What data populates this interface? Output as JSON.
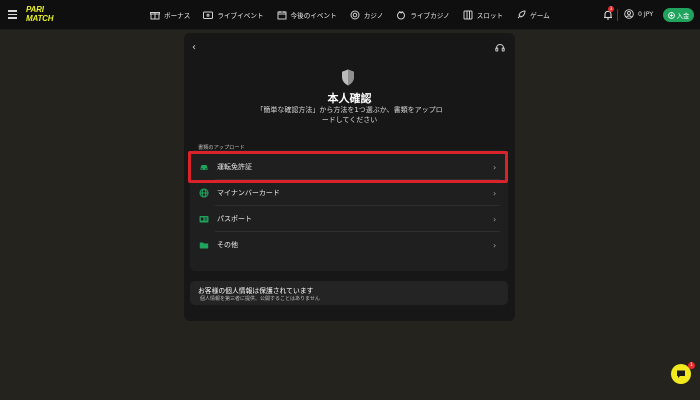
{
  "header": {
    "logo_line1": "PARI",
    "logo_line2": "MATCH",
    "nav": [
      {
        "label": "ボーナス",
        "icon": "gift-icon"
      },
      {
        "label": "ライブイベント",
        "icon": "live-tv-icon"
      },
      {
        "label": "今後のイベント",
        "icon": "calendar-icon"
      },
      {
        "label": "カジノ",
        "icon": "casino-chip-icon"
      },
      {
        "label": "ライブカジノ",
        "icon": "live-casino-icon"
      },
      {
        "label": "スロット",
        "icon": "slot-icon"
      },
      {
        "label": "ゲーム",
        "icon": "rocket-icon"
      }
    ],
    "notification_count": "3",
    "balance": "0 JPY",
    "deposit_label": "入金"
  },
  "modal": {
    "title": "本人確認",
    "subtitle": "「簡単な確認方法」から方法を1つ選ぶか、書類をアップロードしてください",
    "section_label": "書類のアップロード",
    "documents": [
      {
        "label": "運転免許証",
        "icon": "car-icon"
      },
      {
        "label": "マイナンバーカード",
        "icon": "globe-icon"
      },
      {
        "label": "パスポート",
        "icon": "id-card-icon"
      },
      {
        "label": "その他",
        "icon": "folder-icon"
      }
    ],
    "privacy_title": "お客様の個人情報は保護されています",
    "privacy_sub": "個人情報を第三者に提供、公開することはありません"
  },
  "chat": {
    "badge_count": "1"
  },
  "colors": {
    "accent_green": "#1fa35d",
    "highlight_red": "#d8232a",
    "logo_yellow": "#e9f22a",
    "chat_yellow": "#f2e91f"
  }
}
